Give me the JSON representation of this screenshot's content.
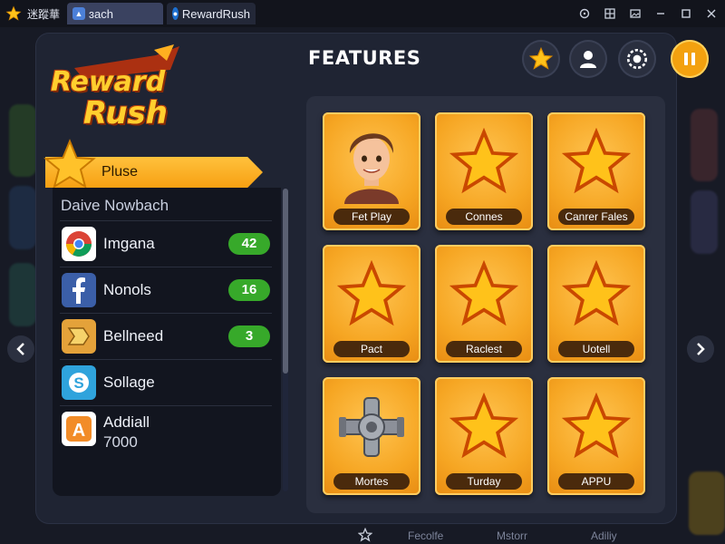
{
  "window": {
    "app_title": "迷蹤華",
    "tabs": [
      {
        "label": "ɜach",
        "icon": "game-icon"
      },
      {
        "label": "RewardRush",
        "icon": "rewardrush-icon"
      }
    ],
    "controls": [
      "target-icon",
      "grid-icon",
      "image-icon",
      "minimize-icon",
      "restore-icon",
      "close-icon"
    ]
  },
  "header": {
    "logo_line1": "Reward",
    "logo_line2": "Rush",
    "title": "FEATURES",
    "buttons": [
      "star-icon",
      "profile-icon",
      "settings-icon",
      "pause-icon"
    ]
  },
  "sidebar": {
    "plus_label": "Pluse",
    "list_title": "Daive Nowbach",
    "friends": [
      {
        "name": "Imgana",
        "badge": "42",
        "icon": "chrome-icon"
      },
      {
        "name": "Nonols",
        "badge": "16",
        "icon": "facebook-icon"
      },
      {
        "name": "Bellneed",
        "badge": "3",
        "icon": "puzzle-app-icon"
      },
      {
        "name": "Sollage",
        "badge": "",
        "icon": "skype-icon"
      },
      {
        "name": "Addiall",
        "sub": "7000",
        "icon": "a-app-icon"
      }
    ]
  },
  "grid": {
    "cards": [
      {
        "label": "Fet Play",
        "icon": "avatar-icon"
      },
      {
        "label": "Connes",
        "icon": "star-icon"
      },
      {
        "label": "Canrer Fales",
        "icon": "star-icon"
      },
      {
        "label": "Pact",
        "icon": "star-icon"
      },
      {
        "label": "Raclest",
        "icon": "star-icon"
      },
      {
        "label": "Uotell",
        "icon": "star-icon"
      },
      {
        "label": "Mortes",
        "icon": "valve-icon"
      },
      {
        "label": "Turday",
        "icon": "star-icon"
      },
      {
        "label": "APPU",
        "icon": "star-icon"
      }
    ]
  },
  "dock": {
    "labels": [
      "Fecolfe",
      "Mstorr",
      "Adiliy"
    ]
  },
  "colors": {
    "accent": "#f6a623",
    "panel": "#1f2433",
    "badge": "#37a92a"
  }
}
